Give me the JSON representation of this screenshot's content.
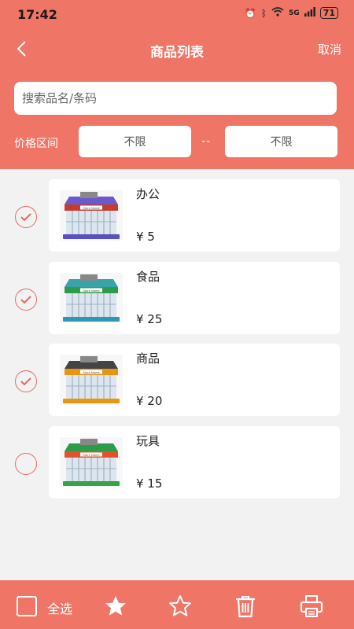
{
  "status_bar": {
    "time": "17:42",
    "network": "5G",
    "battery": "71"
  },
  "nav": {
    "title": "商品列表",
    "cancel_label": "取消"
  },
  "search": {
    "placeholder": "搜索品名/条码"
  },
  "price_filter": {
    "label": "价格区间",
    "min": "不限",
    "separator": "--",
    "max": "不限"
  },
  "products": [
    {
      "name": "办公",
      "price": "¥ 5",
      "checked": true,
      "store_sign": "Store Name",
      "icon": "store-icon"
    },
    {
      "name": "食品",
      "price": "¥ 25",
      "checked": true,
      "store_sign": "Store Name",
      "icon": "store-icon"
    },
    {
      "name": "商品",
      "price": "¥ 20",
      "checked": true,
      "store_sign": "Store Name",
      "icon": "store-icon"
    },
    {
      "name": "玩具",
      "price": "¥ 15",
      "checked": false,
      "store_sign": "Store Name",
      "icon": "store-icon"
    }
  ],
  "bottom_bar": {
    "select_all_label": "全选",
    "icons": [
      "star-filled-icon",
      "star-outline-icon",
      "trash-icon",
      "printer-icon"
    ]
  },
  "colors": {
    "accent": "#ef7567",
    "check": "#e46b63",
    "background": "#f2f2f2"
  }
}
